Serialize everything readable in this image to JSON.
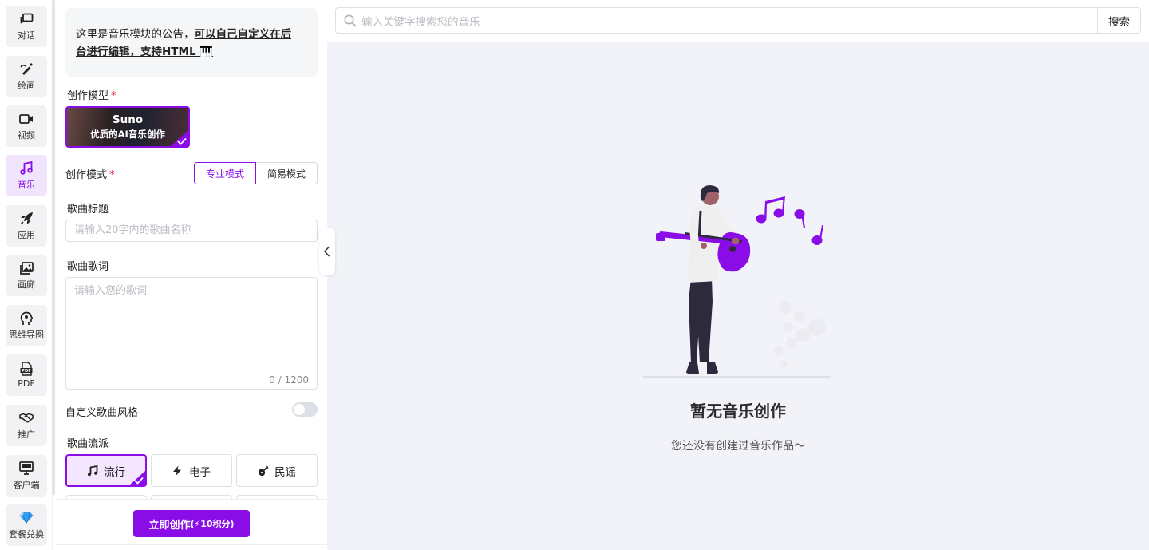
{
  "nav": {
    "items": [
      {
        "label": "对话",
        "icon": "chat-icon"
      },
      {
        "label": "绘画",
        "icon": "brush-icon"
      },
      {
        "label": "视频",
        "icon": "video-icon"
      },
      {
        "label": "音乐",
        "icon": "music-note-icon",
        "active": true
      },
      {
        "label": "应用",
        "icon": "rocket-icon"
      },
      {
        "label": "画廊",
        "icon": "gallery-icon"
      },
      {
        "label": "思维导图",
        "icon": "head-brain-icon"
      },
      {
        "label": "PDF",
        "icon": "pdf-icon"
      },
      {
        "label": "推广",
        "icon": "handshake-icon"
      },
      {
        "label": "客户端",
        "icon": "monitor-icon"
      },
      {
        "label": "套餐兑换",
        "icon": "diamond-icon"
      }
    ]
  },
  "panel": {
    "notice": {
      "text": "这里是音乐模块的公告，",
      "link_line1": "可以自己自定义在后",
      "link_line2": "台进行编辑，支持HTML 🎹"
    },
    "model_label": "创作模型",
    "required_mark": "*",
    "model": {
      "name": "Suno",
      "desc": "优质的AI音乐创作"
    },
    "mode_label": "创作模式",
    "modes": [
      {
        "label": "专业模式",
        "selected": true
      },
      {
        "label": "简易模式",
        "selected": false
      }
    ],
    "title_label": "歌曲标题",
    "title_placeholder": "请输入20字内的歌曲名称",
    "lyrics_label": "歌曲歌词",
    "lyrics_placeholder": "请输入您的歌词",
    "lyrics_count": "0 / 1200",
    "custom_style_label": "自定义歌曲风格",
    "custom_style_on": false,
    "genre_label": "歌曲流派",
    "genres": [
      {
        "label": "流行",
        "icon": "music-note-icon",
        "selected": true
      },
      {
        "label": "电子",
        "icon": "lightning-icon",
        "selected": false
      },
      {
        "label": "民谣",
        "icon": "guitar-icon",
        "selected": false
      }
    ],
    "create_button": "立即创作",
    "create_cost": "(⚡10积分)"
  },
  "main": {
    "search_placeholder": "输入关键字搜索您的音乐",
    "search_button": "搜索",
    "empty_title": "暂无音乐创作",
    "empty_subtitle": "您还没有创建过音乐作品～"
  },
  "colors": {
    "accent": "#8a0ce6",
    "accent_light": "#f1e4fd",
    "main_bg": "#f2f3f8",
    "required": "#e0223a"
  }
}
